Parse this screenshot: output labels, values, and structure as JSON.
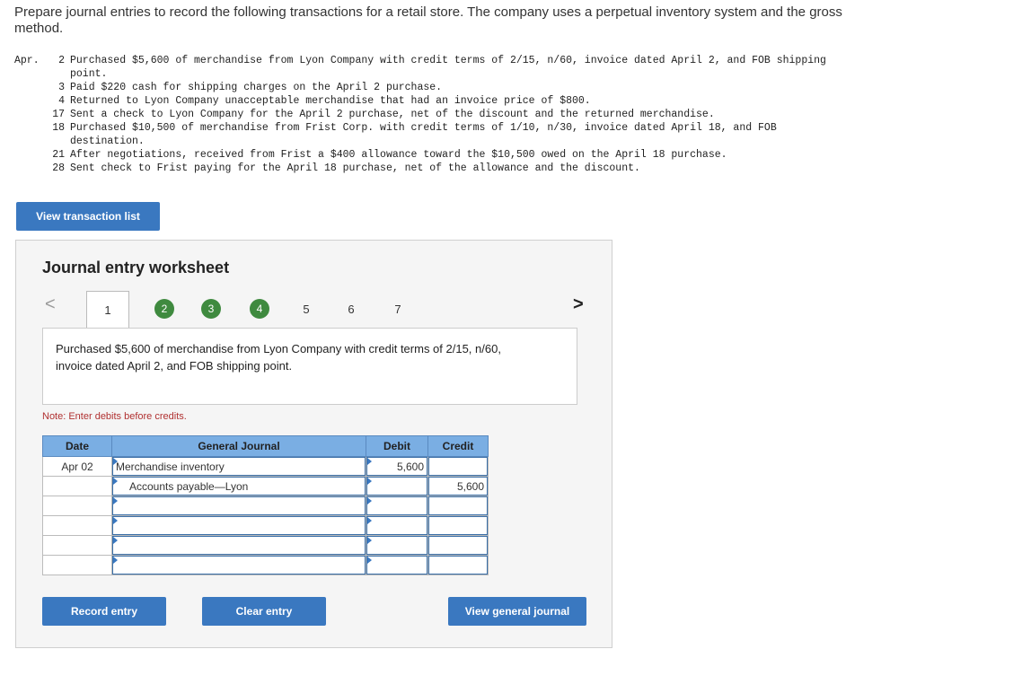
{
  "intro": "Prepare journal entries to record the following transactions for a retail store. The company uses a perpetual inventory system and the gross method.",
  "transactions": {
    "month": "Apr.",
    "items": [
      {
        "day": "2",
        "text": "Purchased $5,600 of merchandise from Lyon Company with credit terms of 2/15, n/60, invoice dated April 2, and FOB shipping",
        "cont": "point."
      },
      {
        "day": "3",
        "text": "Paid $220 cash for shipping charges on the April 2 purchase.",
        "cont": ""
      },
      {
        "day": "4",
        "text": "Returned to Lyon Company unacceptable merchandise that had an invoice price of $800.",
        "cont": ""
      },
      {
        "day": "17",
        "text": "Sent a check to Lyon Company for the April 2 purchase, net of the discount and the returned merchandise.",
        "cont": ""
      },
      {
        "day": "18",
        "text": "Purchased $10,500 of merchandise from Frist Corp. with credit terms of 1/10, n/30, invoice dated April 18, and FOB",
        "cont": "destination."
      },
      {
        "day": "21",
        "text": "After negotiations, received from Frist a $400 allowance toward the $10,500 owed on the April 18 purchase.",
        "cont": ""
      },
      {
        "day": "28",
        "text": "Sent check to Frist paying for the April 18 purchase, net of the allowance and the discount.",
        "cont": ""
      }
    ]
  },
  "buttons": {
    "view_transaction_list": "View transaction list",
    "record_entry": "Record entry",
    "clear_entry": "Clear entry",
    "view_general_journal": "View general journal"
  },
  "worksheet": {
    "title": "Journal entry worksheet",
    "prev_arrow": "<",
    "next_arrow": ">",
    "tabs": [
      "1",
      "2",
      "3",
      "4",
      "5",
      "6",
      "7"
    ],
    "active_tab": "1",
    "completed_tabs": [
      "2",
      "3",
      "4"
    ],
    "description": "Purchased $5,600 of merchandise from Lyon Company with credit terms of 2/15, n/60, invoice dated April 2, and FOB shipping point.",
    "note": "Note: Enter debits before credits."
  },
  "journal": {
    "headers": {
      "date": "Date",
      "account": "General Journal",
      "debit": "Debit",
      "credit": "Credit"
    },
    "rows": [
      {
        "date": "Apr 02",
        "account": "Merchandise inventory",
        "debit": "5,600",
        "credit": ""
      },
      {
        "date": "",
        "account": "Accounts payable—Lyon",
        "debit": "",
        "credit": "5,600"
      },
      {
        "date": "",
        "account": "",
        "debit": "",
        "credit": ""
      },
      {
        "date": "",
        "account": "",
        "debit": "",
        "credit": ""
      },
      {
        "date": "",
        "account": "",
        "debit": "",
        "credit": ""
      },
      {
        "date": "",
        "account": "",
        "debit": "",
        "credit": ""
      }
    ]
  },
  "colors": {
    "button": "#3a78c0",
    "header": "#7aaee3",
    "complete": "#3f8a3f",
    "note": "#b03030"
  }
}
